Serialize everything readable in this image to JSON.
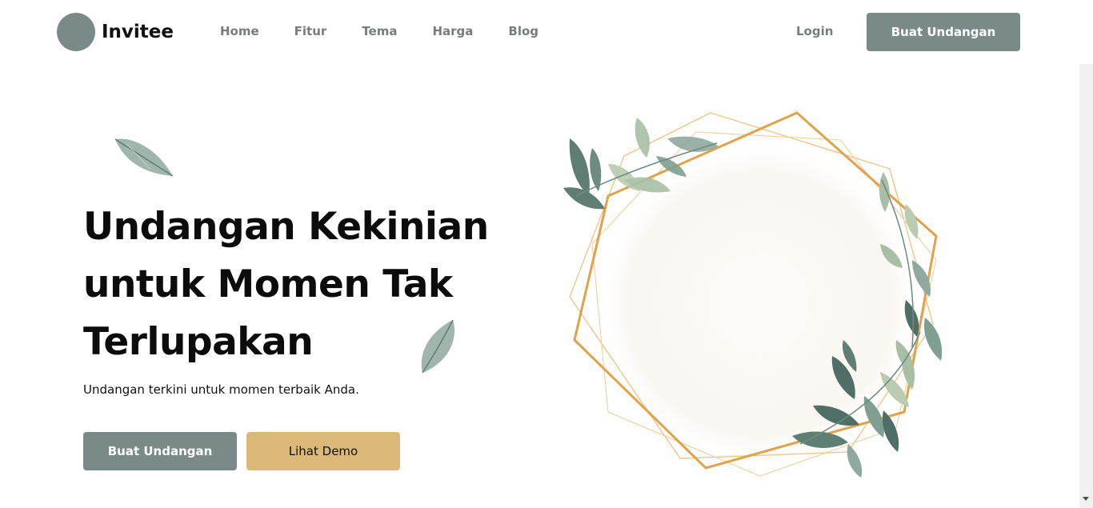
{
  "brand": {
    "name": "Invitee"
  },
  "nav": {
    "links": [
      "Home",
      "Fitur",
      "Tema",
      "Harga",
      "Blog"
    ],
    "login": "Login",
    "cta": "Buat Undangan"
  },
  "hero": {
    "title_lines": [
      "Undangan Kekinian",
      "untuk Momen Tak",
      "Terlupakan"
    ],
    "subtitle": "Undangan terkini untuk momen terbaik Anda.",
    "primary_button": "Buat Undangan",
    "secondary_button": "Lihat Demo"
  },
  "colors": {
    "primary": "#7a8a88",
    "accent": "#dcb978",
    "frame_gold": "#e0a24a",
    "leaf_green": "#5f7f74"
  },
  "icons": [
    "logo-circle-icon",
    "leaf-icon",
    "floral-frame-illustration"
  ]
}
